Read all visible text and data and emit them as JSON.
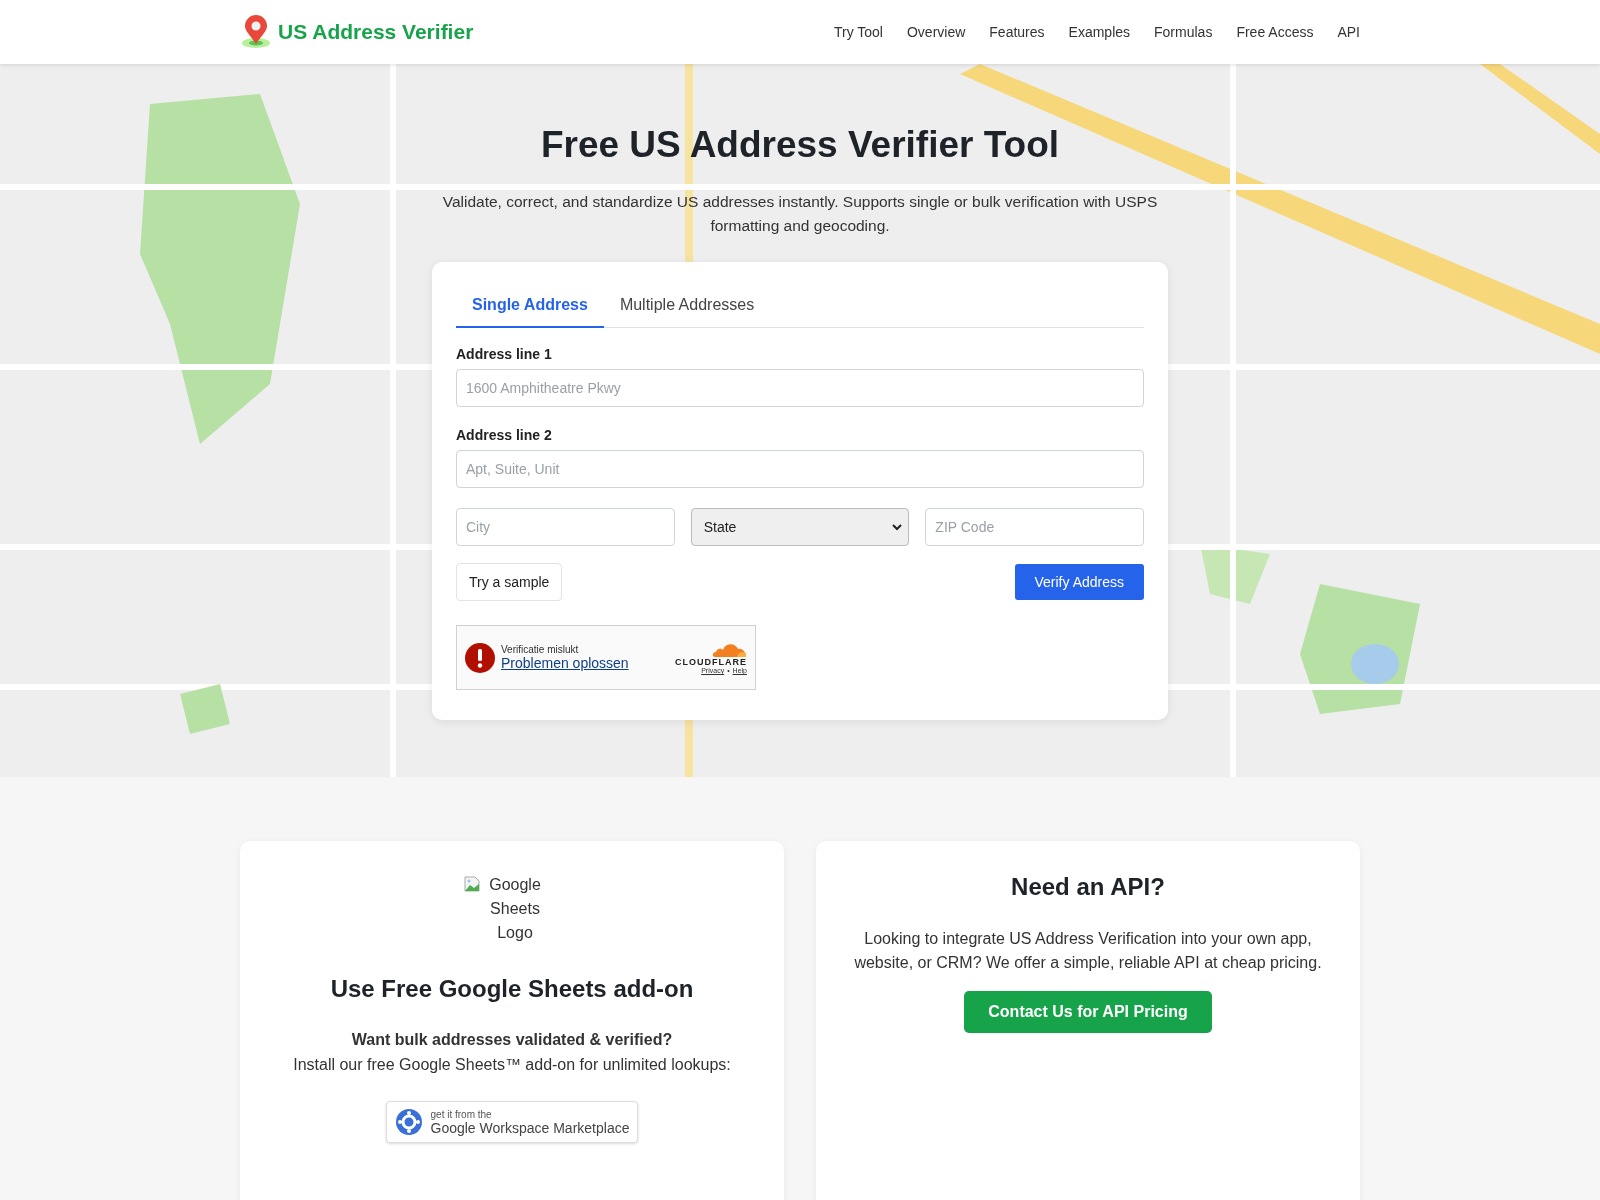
{
  "header": {
    "brand": "US Address Verifier",
    "nav": [
      "Try Tool",
      "Overview",
      "Features",
      "Examples",
      "Formulas",
      "Free Access",
      "API"
    ]
  },
  "hero": {
    "kind": "picture",
    "title": "Free US Address Verifier Tool",
    "subtitle": "Validate, correct, and standardize US addresses instantly. Supports single or bulk verification with USPS formatting and geocoding."
  },
  "form": {
    "tabs": [
      {
        "label": "Single Address",
        "selected": true
      },
      {
        "label": "Multiple Addresses",
        "selected": false
      }
    ],
    "address_line_1": {
      "label": "Address line 1",
      "placeholder": "1600 Amphitheatre Pkwy"
    },
    "address_line_2": {
      "label": "Address line 2",
      "placeholder": "Apt, Suite, Unit"
    },
    "city": {
      "placeholder": "City"
    },
    "state": {
      "value": "State"
    },
    "zip": {
      "placeholder": "ZIP Code"
    },
    "sample_button": "Try a sample",
    "verify_button": "Verify Address",
    "captcha": {
      "status": "Verificatie mislukt",
      "link": "Problemen oplossen",
      "brand": "CLOUDFLARE",
      "privacy": "Privacy",
      "separator": "•",
      "help": "Help"
    }
  },
  "addon_card": {
    "image_alt": "Google Sheets Logo",
    "title": "Use Free Google Sheets add-on",
    "question": "Want bulk addresses validated & verified?",
    "text": "Install our free Google Sheets™ add-on for unlimited lookups:",
    "badge_small": "get it from the",
    "badge_large": "Google Workspace Marketplace"
  },
  "api_card": {
    "title": "Need an API?",
    "text": "Looking to integrate US Address Verification into your own app, website, or CRM? We offer a simple, reliable API at cheap pricing.",
    "button": "Contact Us for API Pricing"
  }
}
